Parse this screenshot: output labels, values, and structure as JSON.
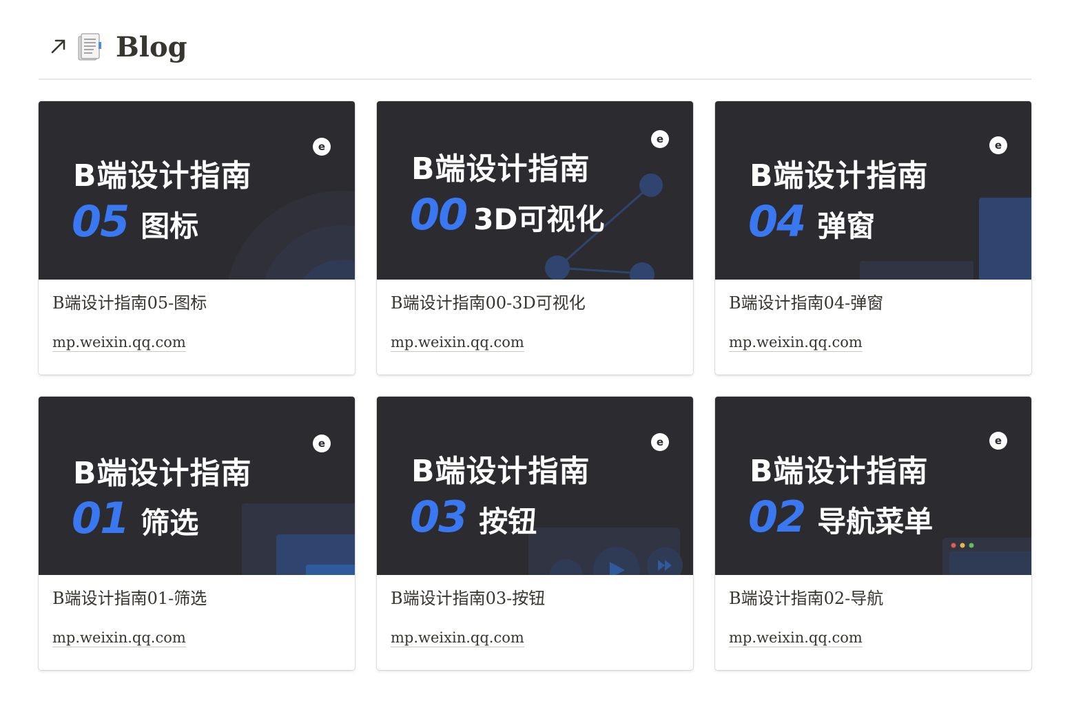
{
  "section": {
    "title": "Blog",
    "link_icon": "arrow-up-right-icon",
    "page_icon": "document-icon"
  },
  "cards": [
    {
      "title": "B端设计指南05-图标",
      "domain": "mp.weixin.qq.com",
      "cover": {
        "headline": "B端设计指南",
        "number": "05",
        "topic": "图标",
        "logo": "e"
      }
    },
    {
      "title": "B端设计指南00-3D可视化",
      "domain": "mp.weixin.qq.com",
      "cover": {
        "headline": "B端设计指南",
        "number": "00",
        "topic": "3D可视化",
        "logo": "e"
      }
    },
    {
      "title": "B端设计指南04-弹窗",
      "domain": "mp.weixin.qq.com",
      "cover": {
        "headline": "B端设计指南",
        "number": "04",
        "topic": "弹窗",
        "logo": "e"
      }
    },
    {
      "title": "B端设计指南01-筛选",
      "domain": "mp.weixin.qq.com",
      "cover": {
        "headline": "B端设计指南",
        "number": "01",
        "topic": "筛选",
        "logo": "e"
      }
    },
    {
      "title": "B端设计指南03-按钮",
      "domain": "mp.weixin.qq.com",
      "cover": {
        "headline": "B端设计指南",
        "number": "03",
        "topic": "按钮",
        "logo": "e"
      }
    },
    {
      "title": "B端设计指南02-导航",
      "domain": "mp.weixin.qq.com",
      "cover": {
        "headline": "B端设计指南",
        "number": "02",
        "topic": "导航菜单",
        "logo": "e"
      }
    }
  ],
  "colors": {
    "cover_bg": "#2b2b30",
    "accent_blue": "#3a78f2",
    "text": "#37352f",
    "divider": "#e6e6e4"
  }
}
